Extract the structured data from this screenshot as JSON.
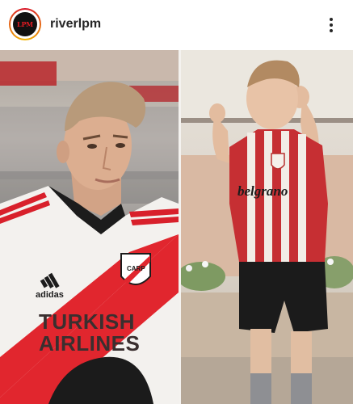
{
  "post": {
    "username": "riverlpm",
    "avatar_text": "LPM"
  },
  "photo": {
    "left": {
      "jersey_brand": "adidas",
      "sponsor_line1": "TURKISH",
      "sponsor_line2": "AIRLINES",
      "crest_text": "CARP"
    },
    "right": {
      "shirt_text": "belgrano"
    }
  },
  "colors": {
    "river_red": "#e1262e",
    "text_dark": "#262626"
  }
}
